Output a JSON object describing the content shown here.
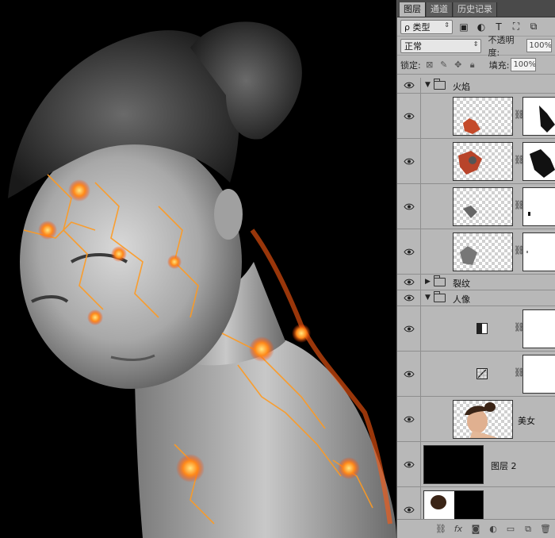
{
  "panel": {
    "tabs": [
      {
        "label": "图层"
      },
      {
        "label": "通道"
      },
      {
        "label": "历史记录"
      }
    ],
    "filter": {
      "value": "ρ 类型"
    },
    "blend_mode": {
      "value": "正常"
    },
    "opacity": {
      "label": "不透明度:",
      "value": "100%"
    },
    "lock": {
      "label": "锁定:"
    },
    "fill": {
      "label": "填充:",
      "value": "100%"
    },
    "layers": {
      "group_fire": {
        "name": "火焰"
      },
      "group_crack": {
        "name": "裂纹"
      },
      "group_portrait": {
        "name": "人像"
      },
      "layer_beauty": {
        "name": "美女"
      },
      "layer_2": {
        "name": "图层 2"
      }
    }
  }
}
